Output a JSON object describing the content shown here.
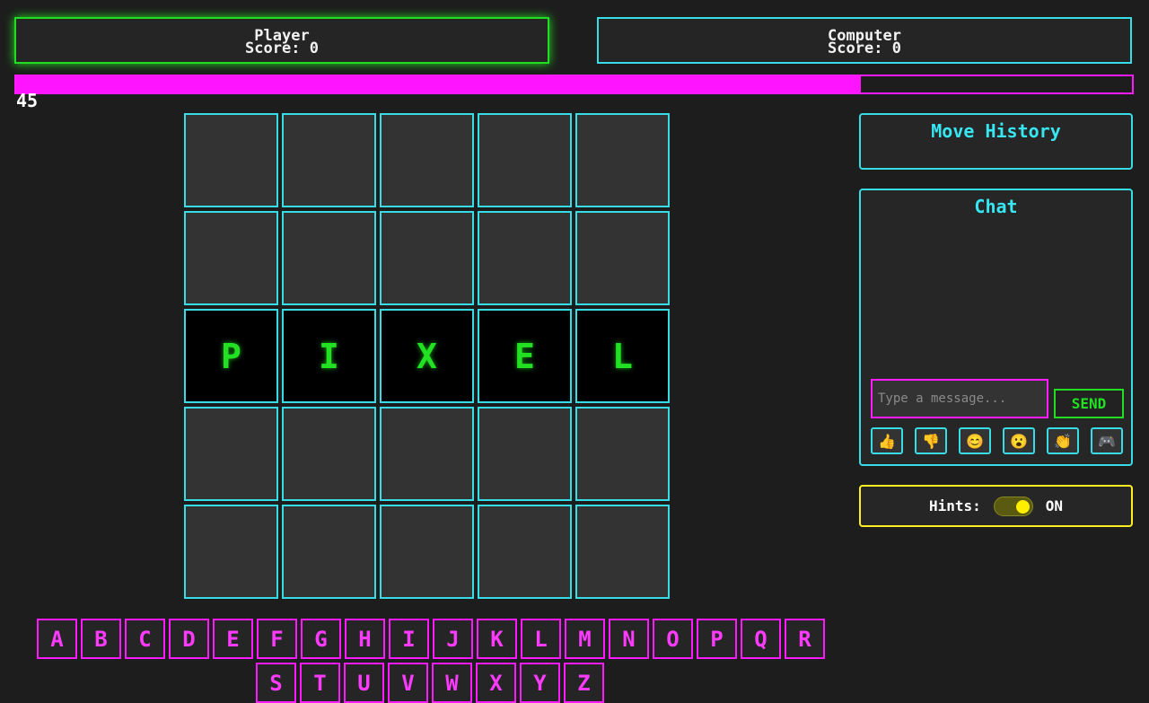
{
  "scores": {
    "player": {
      "name": "Player",
      "score_text": "Score: 0"
    },
    "computer": {
      "name": "Computer",
      "score_text": "Score: 0"
    }
  },
  "timer": {
    "value": "45",
    "fill_fraction": 0.757
  },
  "board": {
    "rows": [
      [
        "",
        "",
        "",
        "",
        ""
      ],
      [
        "",
        "",
        "",
        "",
        ""
      ],
      [
        "P",
        "I",
        "X",
        "E",
        "L"
      ],
      [
        "",
        "",
        "",
        "",
        ""
      ],
      [
        "",
        "",
        "",
        "",
        ""
      ]
    ]
  },
  "move_history": {
    "title": "Move History"
  },
  "chat": {
    "title": "Chat",
    "input_placeholder": "Type a message...",
    "send_label": "SEND",
    "emoji_buttons": [
      {
        "glyph": "👍",
        "icon": "thumbs-up-icon"
      },
      {
        "glyph": "👎",
        "icon": "thumbs-down-icon"
      },
      {
        "glyph": "😊",
        "icon": "smile-icon"
      },
      {
        "glyph": "😮",
        "icon": "surprised-icon"
      },
      {
        "glyph": "👏",
        "icon": "clap-icon"
      },
      {
        "glyph": "🎮",
        "icon": "gamepad-icon"
      }
    ]
  },
  "hints": {
    "label": "Hints:",
    "state": "ON"
  },
  "keyboard": {
    "row1": [
      "A",
      "B",
      "C",
      "D",
      "E",
      "F",
      "G",
      "H",
      "I",
      "J",
      "K",
      "L",
      "M",
      "N",
      "O",
      "P",
      "Q",
      "R"
    ],
    "row2": [
      "S",
      "T",
      "U",
      "V",
      "W",
      "X",
      "Y",
      "Z"
    ]
  }
}
